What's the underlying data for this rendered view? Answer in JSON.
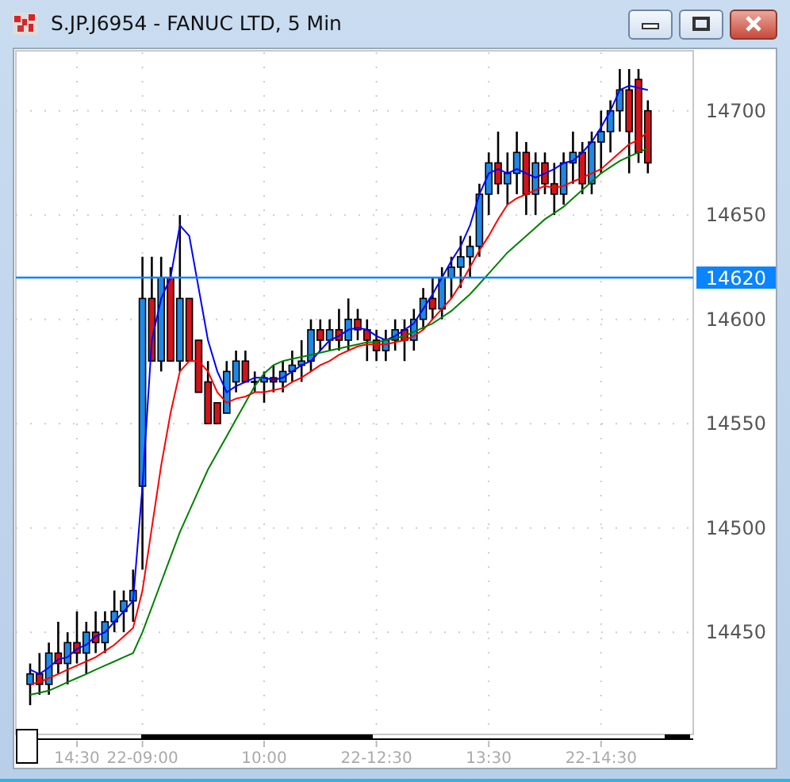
{
  "window": {
    "title": "S.JP.J6954 - FANUC LTD, 5 Min"
  },
  "chart": {
    "chart_data": {
      "type": "candlestick",
      "grid": true,
      "ylim": [
        14401,
        14728
      ],
      "yticks": [
        14450,
        14500,
        14550,
        14600,
        14650,
        14700
      ],
      "categories": [
        null,
        null,
        null,
        null,
        null,
        "14:30",
        null,
        null,
        null,
        null,
        null,
        null,
        "22-09:00",
        null,
        null,
        null,
        null,
        null,
        null,
        null,
        null,
        null,
        null,
        null,
        null,
        "10:00",
        null,
        null,
        null,
        null,
        null,
        null,
        null,
        null,
        null,
        null,
        null,
        "22-12:30",
        null,
        null,
        null,
        null,
        null,
        null,
        null,
        null,
        null,
        null,
        null,
        "13:30",
        null,
        null,
        null,
        null,
        null,
        null,
        null,
        null,
        null,
        null,
        null,
        "22-14:30",
        null,
        null,
        null,
        null,
        null
      ],
      "ohlc": [
        [
          14425,
          14435,
          14415,
          14430
        ],
        [
          14430,
          14440,
          14420,
          14425
        ],
        [
          14425,
          14445,
          14420,
          14440
        ],
        [
          14440,
          14455,
          14430,
          14435
        ],
        [
          14435,
          14450,
          14425,
          14445
        ],
        [
          14445,
          14460,
          14435,
          14440
        ],
        [
          14440,
          14455,
          14430,
          14450
        ],
        [
          14450,
          14460,
          14440,
          14445
        ],
        [
          14445,
          14460,
          14440,
          14455
        ],
        [
          14455,
          14470,
          14450,
          14460
        ],
        [
          14460,
          14470,
          14450,
          14465
        ],
        [
          14465,
          14480,
          14455,
          14470
        ],
        [
          14520,
          14630,
          14480,
          14610
        ],
        [
          14610,
          14630,
          14580,
          14580
        ],
        [
          14580,
          14630,
          14575,
          14620
        ],
        [
          14620,
          14625,
          14580,
          14580
        ],
        [
          14580,
          14650,
          14575,
          14610
        ],
        [
          14610,
          14610,
          14580,
          14580
        ],
        [
          14590,
          14590,
          14565,
          14565
        ],
        [
          14570,
          14580,
          14550,
          14550
        ],
        [
          14560,
          14560,
          14550,
          14550
        ],
        [
          14555,
          14580,
          14555,
          14575
        ],
        [
          14570,
          14585,
          14565,
          14580
        ],
        [
          14580,
          14585,
          14570,
          14570
        ],
        [
          14570,
          14575,
          14565,
          14570
        ],
        [
          14570,
          14575,
          14560,
          14572
        ],
        [
          14572,
          14578,
          14565,
          14570
        ],
        [
          14570,
          14580,
          14565,
          14575
        ],
        [
          14575,
          14585,
          14570,
          14578
        ],
        [
          14578,
          14590,
          14570,
          14580
        ],
        [
          14580,
          14600,
          14575,
          14595
        ],
        [
          14595,
          14600,
          14585,
          14590
        ],
        [
          14590,
          14600,
          14585,
          14595
        ],
        [
          14595,
          14605,
          14585,
          14590
        ],
        [
          14590,
          14610,
          14585,
          14600
        ],
        [
          14600,
          14605,
          14590,
          14595
        ],
        [
          14595,
          14600,
          14580,
          14590
        ],
        [
          14590,
          14595,
          14580,
          14585
        ],
        [
          14585,
          14595,
          14580,
          14590
        ],
        [
          14590,
          14600,
          14585,
          14595
        ],
        [
          14595,
          14600,
          14580,
          14590
        ],
        [
          14590,
          14605,
          14585,
          14600
        ],
        [
          14600,
          14615,
          14595,
          14610
        ],
        [
          14610,
          14620,
          14600,
          14605
        ],
        [
          14605,
          14625,
          14600,
          14620
        ],
        [
          14620,
          14630,
          14610,
          14625
        ],
        [
          14625,
          14640,
          14615,
          14630
        ],
        [
          14630,
          14640,
          14620,
          14635
        ],
        [
          14635,
          14665,
          14630,
          14660
        ],
        [
          14660,
          14680,
          14650,
          14675
        ],
        [
          14675,
          14690,
          14660,
          14665
        ],
        [
          14665,
          14680,
          14655,
          14670
        ],
        [
          14670,
          14690,
          14660,
          14680
        ],
        [
          14680,
          14685,
          14650,
          14660
        ],
        [
          14660,
          14680,
          14650,
          14675
        ],
        [
          14675,
          14680,
          14660,
          14665
        ],
        [
          14665,
          14675,
          14650,
          14660
        ],
        [
          14660,
          14680,
          14655,
          14675
        ],
        [
          14675,
          14690,
          14665,
          14680
        ],
        [
          14680,
          14685,
          14660,
          14665
        ],
        [
          14665,
          14690,
          14660,
          14685
        ],
        [
          14685,
          14700,
          14670,
          14690
        ],
        [
          14690,
          14705,
          14680,
          14700
        ],
        [
          14700,
          14720,
          14690,
          14710
        ],
        [
          14710,
          14720,
          14670,
          14690
        ],
        [
          14715,
          14720,
          14675,
          14680
        ],
        [
          14700,
          14705,
          14670,
          14675
        ]
      ],
      "series": [
        {
          "type": "line",
          "color": "#0000ff",
          "values": [
            14432,
            14430,
            14433,
            14437,
            14438,
            14442,
            14444,
            14448,
            14450,
            14455,
            14460,
            14465,
            14520,
            14590,
            14610,
            14620,
            14645,
            14640,
            14615,
            14590,
            14575,
            14565,
            14568,
            14570,
            14572,
            14572,
            14571,
            14572,
            14575,
            14578,
            14580,
            14585,
            14590,
            14592,
            14595,
            14596,
            14595,
            14592,
            14590,
            14592,
            14595,
            14598,
            14605,
            14612,
            14620,
            14628,
            14635,
            14645,
            14660,
            14670,
            14672,
            14670,
            14672,
            14670,
            14668,
            14670,
            14672,
            14675,
            14676,
            14680,
            14685,
            14692,
            14700,
            14710,
            14712,
            14711,
            14710
          ]
        },
        {
          "type": "line",
          "color": "#ff0000",
          "values": [
            14425,
            14426,
            14428,
            14430,
            14432,
            14434,
            14436,
            14438,
            14441,
            14444,
            14448,
            14452,
            14470,
            14500,
            14530,
            14555,
            14575,
            14580,
            14580,
            14575,
            14565,
            14560,
            14562,
            14563,
            14565,
            14565,
            14566,
            14567,
            14570,
            14572,
            14575,
            14578,
            14580,
            14583,
            14585,
            14587,
            14588,
            14588,
            14588,
            14589,
            14590,
            14592,
            14595,
            14600,
            14605,
            14610,
            14617,
            14625,
            14633,
            14640,
            14648,
            14655,
            14658,
            14660,
            14662,
            14664,
            14663,
            14664,
            14666,
            14668,
            14670,
            14672,
            14676,
            14680,
            14684,
            14686,
            14690
          ]
        },
        {
          "type": "line",
          "color": "#008000",
          "values": [
            14420,
            14421,
            14422,
            14424,
            14426,
            14428,
            14430,
            14432,
            14434,
            14436,
            14438,
            14440,
            14450,
            14462,
            14474,
            14486,
            14498,
            14508,
            14518,
            14528,
            14536,
            14544,
            14552,
            14560,
            14568,
            14574,
            14578,
            14580,
            14581,
            14582,
            14583,
            14584,
            14585,
            14586,
            14587,
            14588,
            14589,
            14589,
            14590,
            14591,
            14592,
            14594,
            14596,
            14598,
            14601,
            14604,
            14608,
            14612,
            14617,
            14622,
            14627,
            14632,
            14636,
            14640,
            14644,
            14648,
            14651,
            14654,
            14658,
            14662,
            14666,
            14670,
            14673,
            14676,
            14678,
            14680,
            14682
          ]
        }
      ],
      "ref_lines": [
        {
          "axis": "y",
          "value": 14620,
          "label": "14620"
        }
      ]
    }
  }
}
